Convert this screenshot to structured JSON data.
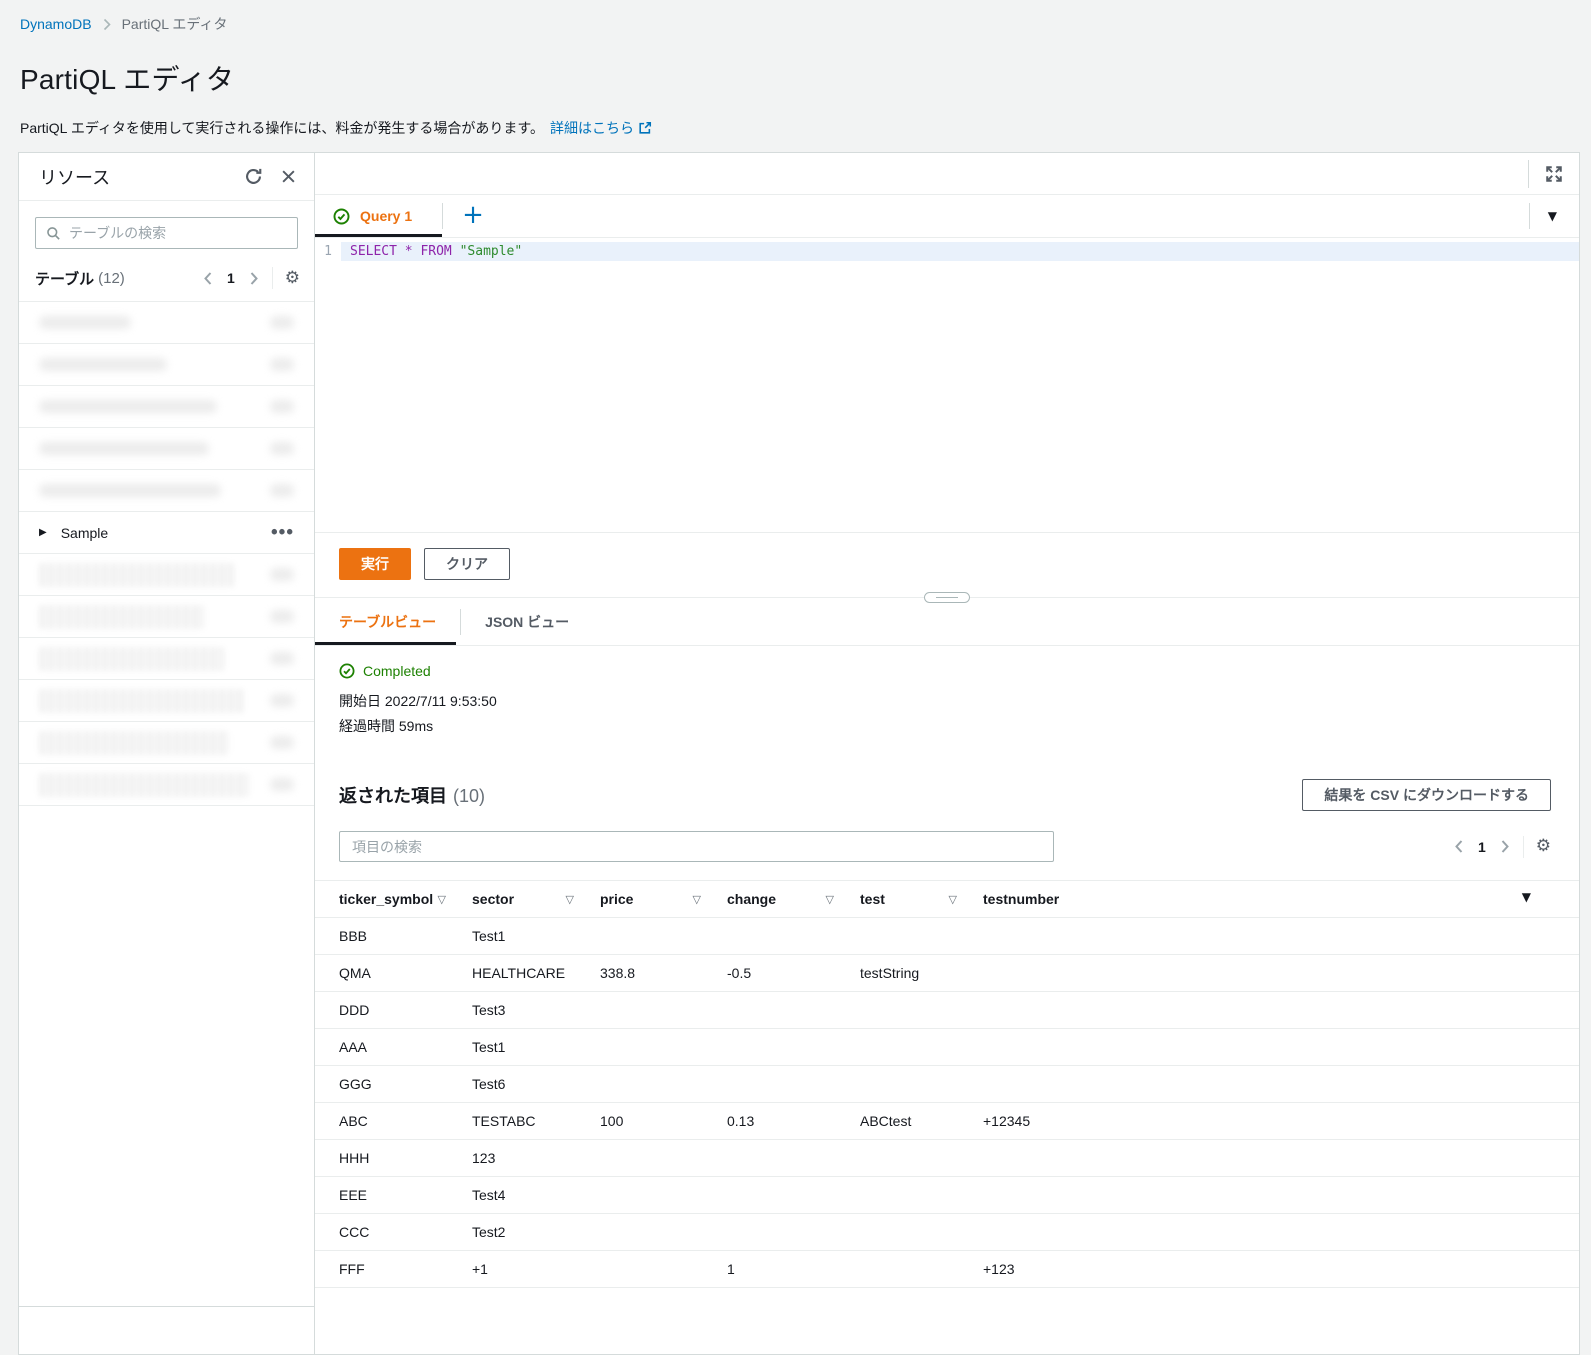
{
  "colors": {
    "accent": "#ec7211",
    "link": "#0073bb",
    "success": "#1d8102"
  },
  "icons": {
    "gear": "⚙",
    "sort": "▽",
    "filter": "▼",
    "caret_down": "▼",
    "expander": "▶",
    "ellipsis": "•••",
    "plus": "+"
  },
  "page": {
    "breadcrumb_root": "DynamoDB",
    "breadcrumb_current": "PartiQL エディタ",
    "title": "PartiQL エディタ",
    "description": "PartiQL エディタを使用して実行される操作には、料金が発生する場合があります。",
    "learn_more": "詳細はこちら"
  },
  "sidebar": {
    "title": "リソース",
    "search_placeholder": "テーブルの検索",
    "tables_label": "テーブル",
    "tables_count": "(12)",
    "page_number": "1",
    "sample_item": "Sample"
  },
  "query": {
    "tab_label": "Query 1",
    "line_number": "1",
    "code_kw1": "SELECT",
    "code_star": "*",
    "code_kw2": "FROM",
    "code_table": "\"Sample\"",
    "run_label": "実行",
    "clear_label": "クリア"
  },
  "results": {
    "tab_table": "テーブルビュー",
    "tab_json": "JSON ビュー",
    "status": "Completed",
    "started_label": "開始日",
    "started_value": "2022/7/11 9:53:50",
    "elapsed_label": "経過時間",
    "elapsed_value": "59ms",
    "returned_label": "返された項目",
    "returned_count": "(10)",
    "csv_button": "結果を CSV にダウンロードする",
    "search_placeholder": "項目の検索",
    "page_number": "1",
    "columns": [
      "ticker_symbol",
      "sector",
      "price",
      "change",
      "test",
      "testnumber"
    ],
    "rows": [
      [
        "BBB",
        "Test1",
        "",
        "",
        "",
        ""
      ],
      [
        "QMA",
        "HEALTHCARE",
        "338.8",
        "-0.5",
        "testString",
        ""
      ],
      [
        "DDD",
        "Test3",
        "",
        "",
        "",
        ""
      ],
      [
        "AAA",
        "Test1",
        "",
        "",
        "",
        ""
      ],
      [
        "GGG",
        "Test6",
        "",
        "",
        "",
        ""
      ],
      [
        "ABC",
        "TESTABC",
        "100",
        "0.13",
        "ABCtest",
        "+12345"
      ],
      [
        "HHH",
        "123",
        "",
        "",
        "",
        ""
      ],
      [
        "EEE",
        "Test4",
        "",
        "",
        "",
        ""
      ],
      [
        "CCC",
        "Test2",
        "",
        "",
        "",
        ""
      ],
      [
        "FFF",
        "+1",
        "",
        "1",
        "",
        "+123"
      ]
    ]
  }
}
